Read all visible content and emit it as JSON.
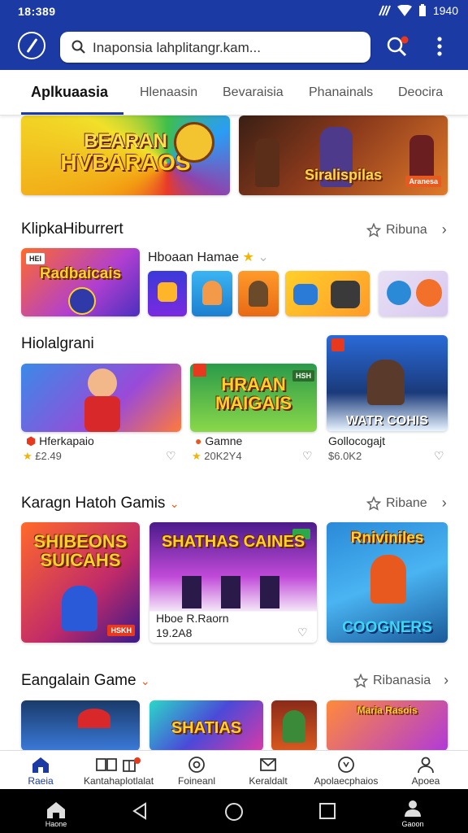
{
  "status": {
    "time": "18:389",
    "right_time": "1940"
  },
  "search": {
    "placeholder": "Inaponsia lahplitangr.kam..."
  },
  "tabs": [
    {
      "label": "Aplkuaasia",
      "active": true
    },
    {
      "label": "Hlenaasin"
    },
    {
      "label": "Bevaraisia"
    },
    {
      "label": "Phanainals"
    },
    {
      "label": "Deocira"
    }
  ],
  "banners": [
    {
      "text_a": "BEARAN",
      "text_b": "HVBARAOS"
    },
    {
      "text": "Siralispilas",
      "badge": "Aranesa"
    }
  ],
  "section1": {
    "title": "KlipkaHiburrert",
    "more": "Ribuna",
    "subheading": "Hboaan Hamae",
    "feature_art": "Radbaicais",
    "feature_badge": "HEI"
  },
  "section2": {
    "title": "Hiolalgrani",
    "cards": [
      {
        "label": "Hferkapaio",
        "sub": "£2.49"
      },
      {
        "label": "Gamne",
        "sub": "20K2Y4",
        "art": "HRAAN MAIGAIS",
        "badge": "HSH"
      },
      {
        "label": "Gollocogajt",
        "sub": "$6.0K2",
        "art": "WATR COHIS"
      }
    ]
  },
  "section3": {
    "title": "Karagn Hatoh Gamis",
    "more": "Ribane",
    "cards": [
      {
        "art": "SHIBEONS SUICAHS",
        "badge": "HSKH"
      },
      {
        "label": "Hboe R.Raorn",
        "sub": "19.2A8",
        "art": "SHATHAS CAINES"
      },
      {
        "art_a": "Rniviniles",
        "art_b": "COOGNERS"
      }
    ]
  },
  "section4": {
    "title": "Eangalain Game",
    "more": "Ribanasia",
    "arts": [
      "SHATIAS",
      "Maria Rasois"
    ]
  },
  "bottom_nav": [
    {
      "label": "Raeia",
      "icon": "home-icon",
      "active": true
    },
    {
      "label": "Kantahaplotlalat",
      "icon": "book-icon"
    },
    {
      "label": "Foineanl",
      "icon": "circle-icon"
    },
    {
      "label": "Keraldalt",
      "icon": "envelope-icon"
    },
    {
      "label": "Apolaecphaios",
      "icon": "clock-icon"
    },
    {
      "label": "Apoea",
      "icon": "profile-icon"
    }
  ],
  "sys_nav": {
    "left_label": "Haone",
    "right_label": "Gaoon"
  },
  "colors": {
    "brand": "#1c3aa3",
    "badge": "#e8391f",
    "star": "#f4b400"
  }
}
